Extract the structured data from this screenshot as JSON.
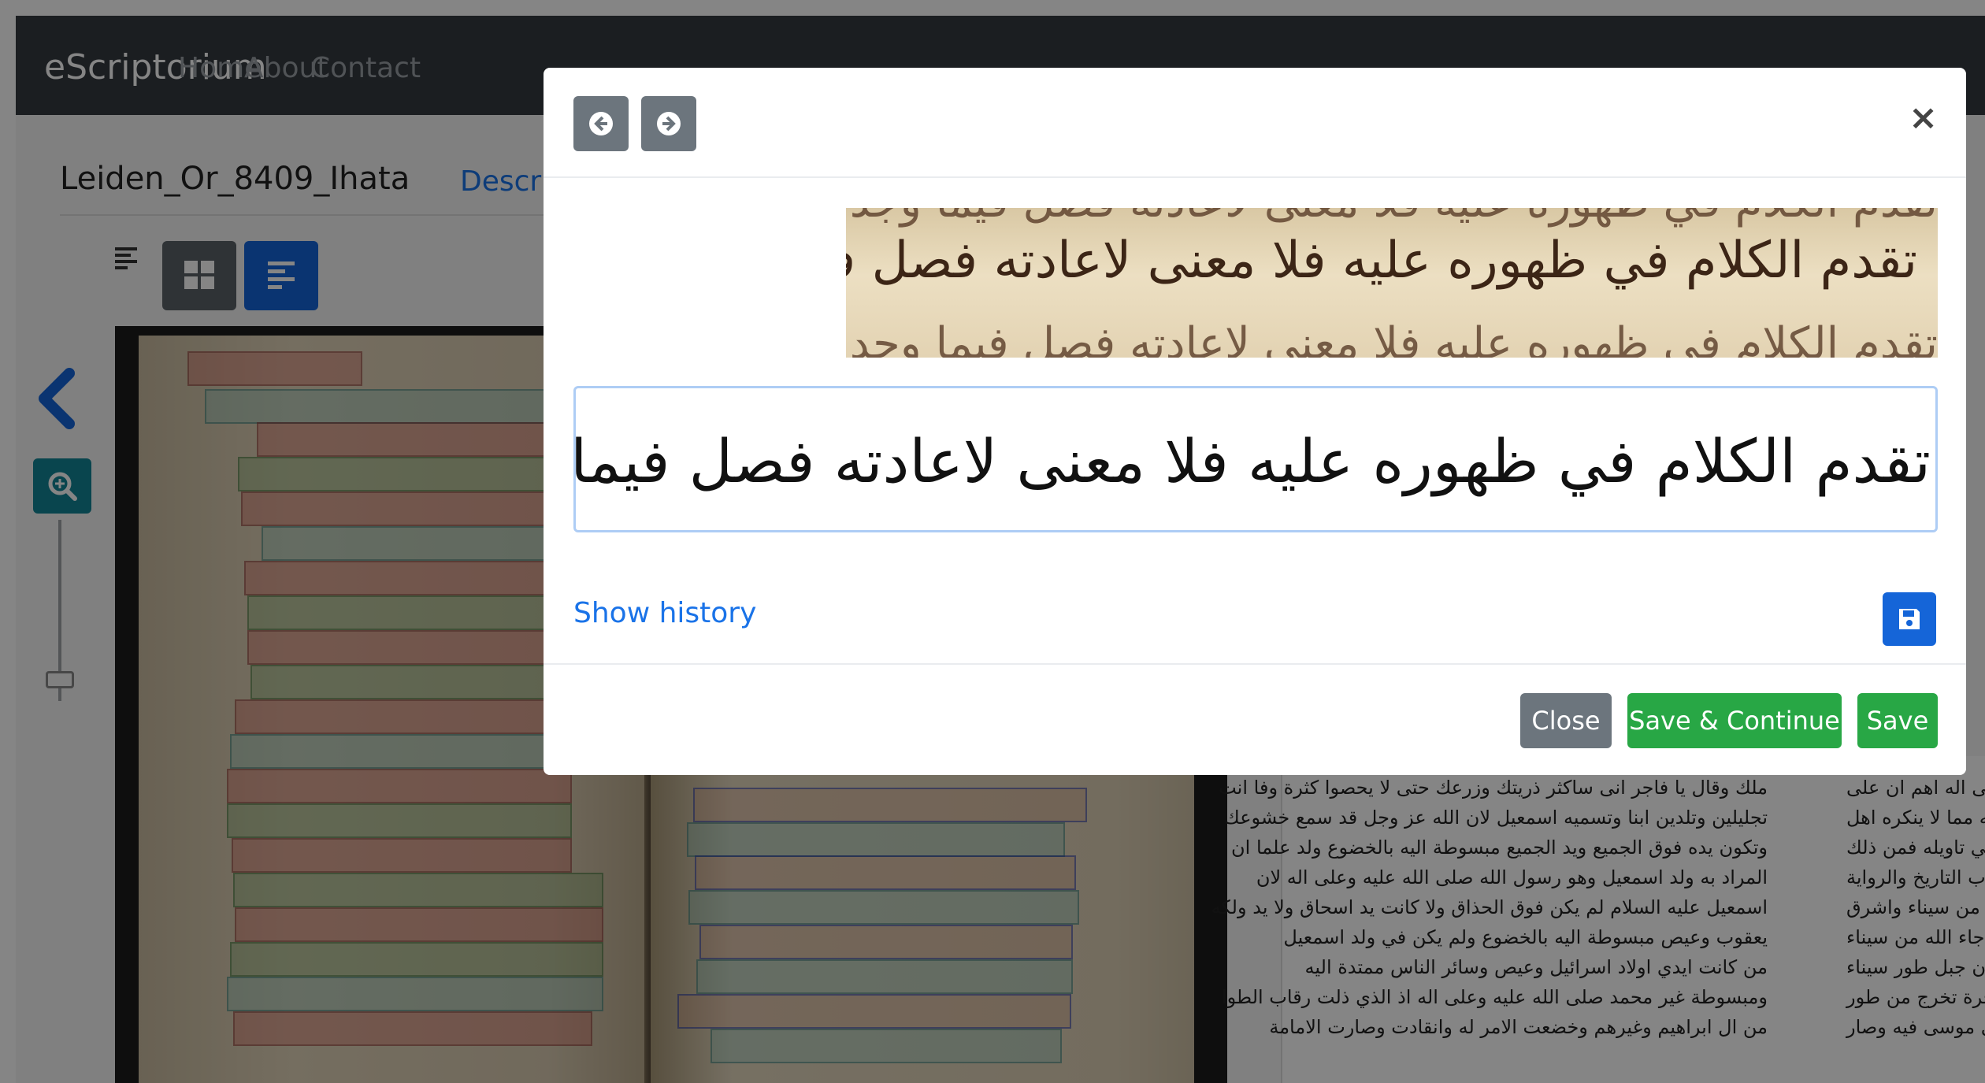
{
  "navbar": {
    "brand": "eScriptorium",
    "links": [
      "Home",
      "About",
      "Contact"
    ]
  },
  "document": {
    "title": "Leiden_Or_8409_Ihata",
    "tab_label": "Descri"
  },
  "modal": {
    "line_image_text": "تقدم الكلام في ظهوره عليه فلا معنى لاعادته فصل فيما وجد في",
    "transcription_value": "تقدم الكلام في ظهوره عليه فلا معنى لاعادته فصل فيما وجد في",
    "show_history_label": "Show history",
    "buttons": {
      "close": "Close",
      "save_continue": "Save & Continue",
      "save": "Save"
    }
  },
  "text_panel": {
    "lines": [
      "ملك وقال يا فاجر انى ساكثر ذريتك وزرعك حتى لا يحصوا كثرة وفا انت",
      "تجليلين وتلدين ابنا وتسميه اسمعيل لان الله عز وجل قد سمع خشوعك",
      "وتكون يده فوق الجميع ويد الجميع مبسوطة اليه بالخضوع ولد علما ان",
      "المراد به ولد اسمعيل وهو رسول الله صلى الله عليه وعلى اله لان",
      "اسمعيل عليه السلام لم يكن فوق الحذاق ولا كانت يد اسحاق ولا يد ولكه",
      "يعقوب وعيص مبسوطة اليه بالخضوع ولم يكن في ولد اسمعيل",
      "من كانت ايدي اولاد اسرائيل وعيص وسائر الناس ممتدة اليه",
      "ومبسوطة غير محمد صلى الله عليه وعلى اله اذ الذي ذلت رقاب الطوا",
      "من ال ابراهيم وغيرهم وخضعت الامر له وانقادت وصارت الامامة"
    ],
    "side_lines": [
      "وعلى اله اهم ان على",
      "منه مما لا ينكره اهل",
      "ينا في تاويله فمن ذلك",
      "حاب التاريخ والرواية",
      "الله من سيناء واشرق",
      "ء جاء الله من سيناء",
      "ن جبل طور سيناء",
      "وشجرة تخرج من طور",
      "ي موسى فيه وصار"
    ]
  },
  "colors": {
    "navbar_bg": "#343a40",
    "primary": "#1565d8",
    "success": "#28a745",
    "secondary": "#6c757d",
    "link": "#1a73e8"
  },
  "icons": [
    "arrow-left-circle-icon",
    "arrow-right-circle-icon",
    "close-icon",
    "save-icon",
    "grid-icon",
    "text-lines-icon",
    "chevron-left-icon",
    "zoom-icon"
  ]
}
